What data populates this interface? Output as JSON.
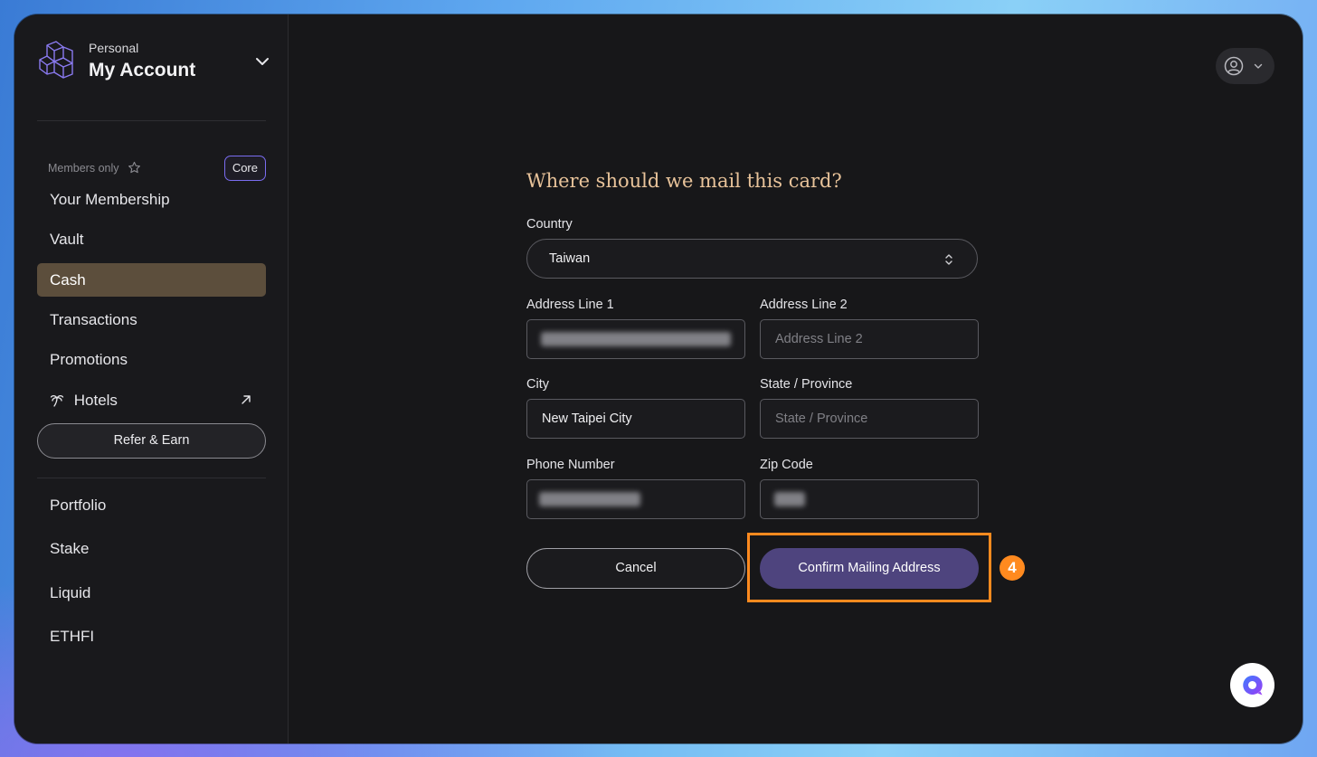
{
  "account": {
    "subtitle": "Personal",
    "title": "My Account"
  },
  "sidebar": {
    "members_label": "Members only",
    "badge": "Core",
    "items": [
      {
        "label": "Your Membership",
        "active": false
      },
      {
        "label": "Vault",
        "active": false
      },
      {
        "label": "Cash",
        "active": true
      },
      {
        "label": "Transactions",
        "active": false
      },
      {
        "label": "Promotions",
        "active": false
      },
      {
        "label": "Hotels",
        "active": false,
        "icon": "palm-tree-icon",
        "external": true
      }
    ],
    "refer_button": "Refer & Earn",
    "secondary_items": [
      {
        "label": "Portfolio"
      },
      {
        "label": "Stake"
      },
      {
        "label": "Liquid"
      },
      {
        "label": "ETHFI"
      }
    ]
  },
  "form": {
    "title": "Where should we mail this card?",
    "country": {
      "label": "Country",
      "value": "Taiwan"
    },
    "address_line_1": {
      "label": "Address Line 1",
      "value": ""
    },
    "address_line_2": {
      "label": "Address Line 2",
      "placeholder": "Address Line 2"
    },
    "city": {
      "label": "City",
      "value": "New Taipei City"
    },
    "state": {
      "label": "State / Province",
      "placeholder": "State / Province"
    },
    "phone": {
      "label": "Phone Number",
      "value": ""
    },
    "zip": {
      "label": "Zip Code",
      "value": ""
    },
    "cancel_button": "Cancel",
    "confirm_button": "Confirm Mailing Address"
  },
  "annotation": {
    "step": "4",
    "color": "#ff8a1f"
  },
  "colors": {
    "accent": "#4e447e",
    "active_nav": "#5c4e3c",
    "title": "#e8c39a",
    "badge_border": "#7a6cf0"
  }
}
